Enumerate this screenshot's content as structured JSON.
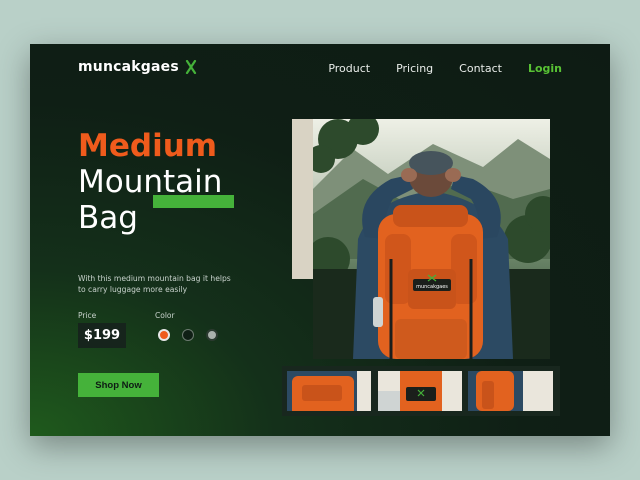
{
  "brand": {
    "name": "muncakgaes",
    "accent": "#45b23a"
  },
  "nav": {
    "items": [
      "Product",
      "Pricing",
      "Contact"
    ],
    "login": "Login"
  },
  "hero": {
    "title_line1": "Medium",
    "title_line2": "Mountain",
    "title_line3": "Bag",
    "description": "With this medium mountain bag it helps to carry luggage more easily",
    "price_label": "Price",
    "price": "$199",
    "color_label": "Color",
    "colors": [
      "#ef5b1c",
      "#0f1f15",
      "#a9b1ac"
    ],
    "cta": "Shop Now"
  },
  "product": {
    "bag_tag": "muncakgaes",
    "thumbnails": [
      "thumbnail-bag-top",
      "thumbnail-bag-front",
      "thumbnail-bag-side"
    ]
  }
}
